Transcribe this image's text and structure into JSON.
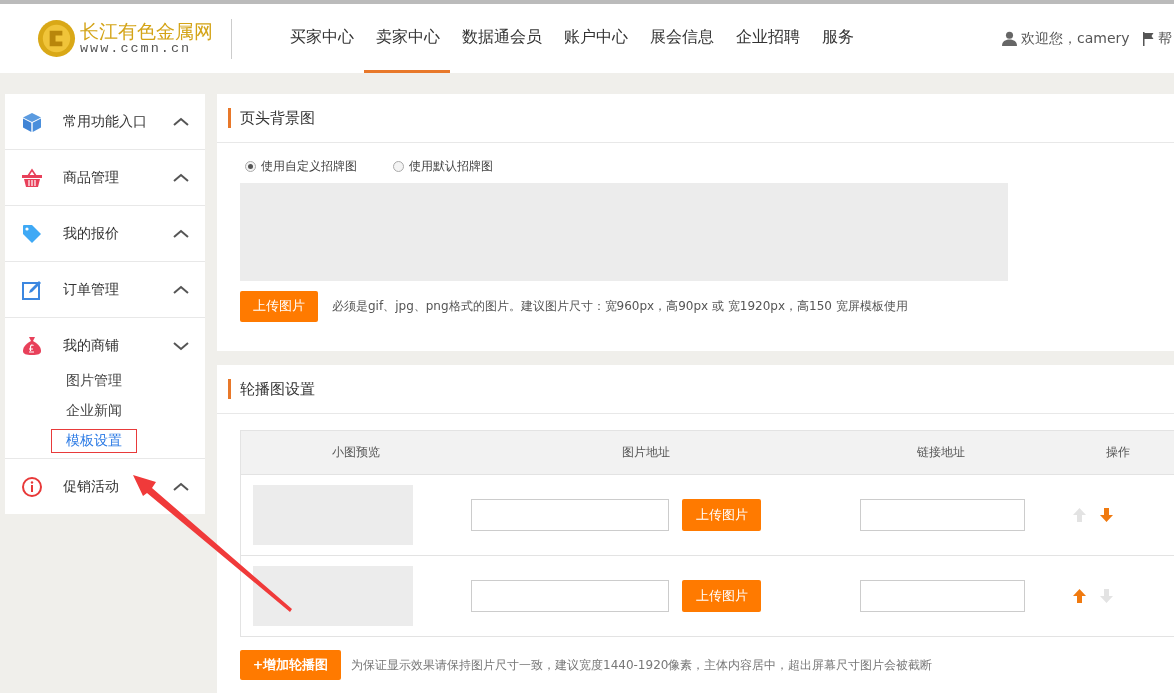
{
  "header": {
    "logo": {
      "name": "长江有色金属网",
      "url": "www.ccmn.cn"
    },
    "nav": [
      {
        "label": "买家中心",
        "selected": false
      },
      {
        "label": "卖家中心",
        "selected": true
      },
      {
        "label": "数据通会员",
        "selected": false
      },
      {
        "label": "账户中心",
        "selected": false
      },
      {
        "label": "展会信息",
        "selected": false
      },
      {
        "label": "企业招聘",
        "selected": false
      },
      {
        "label": "服务",
        "selected": false
      }
    ],
    "user": "欢迎您，camery",
    "help": "帮"
  },
  "sidebar": {
    "groups": [
      {
        "label": "常用功能入口",
        "kind": "cube",
        "expanded": false
      },
      {
        "label": "商品管理",
        "kind": "basket",
        "expanded": false
      },
      {
        "label": "我的报价",
        "kind": "tag",
        "expanded": false
      },
      {
        "label": "订单管理",
        "kind": "edit",
        "expanded": false
      },
      {
        "label": "我的商铺",
        "kind": "bag",
        "expanded": true,
        "children": [
          {
            "label": "图片管理",
            "selected": false
          },
          {
            "label": "企业新闻",
            "selected": false
          },
          {
            "label": "模板设置",
            "selected": true
          }
        ]
      },
      {
        "label": "促销活动",
        "kind": "info",
        "expanded": false
      }
    ]
  },
  "banner": {
    "title": "页头背景图",
    "options": [
      {
        "label": "使用自定义招牌图",
        "selected": true
      },
      {
        "label": "使用默认招牌图",
        "selected": false
      }
    ],
    "upload_button": "上传图片",
    "hint": "必须是gif、jpg、png格式的图片。建议图片尺寸：宽960px，高90px 或 宽1920px，高150 宽屏模板使用"
  },
  "carousel": {
    "title": "轮播图设置",
    "columns": [
      "小图预览",
      "图片地址",
      "链接地址",
      "操作"
    ],
    "rows": [
      {
        "upload_button": "上传图片",
        "up_enabled": false,
        "down_enabled": true
      },
      {
        "upload_button": "上传图片",
        "up_enabled": true,
        "down_enabled": false
      }
    ],
    "add_button": "+增加轮播图",
    "hint": "为保证显示效果请保持图片尺寸一致，建议宽度1440-1920像素，主体内容居中，超出屏幕尺寸图片会被截断"
  }
}
